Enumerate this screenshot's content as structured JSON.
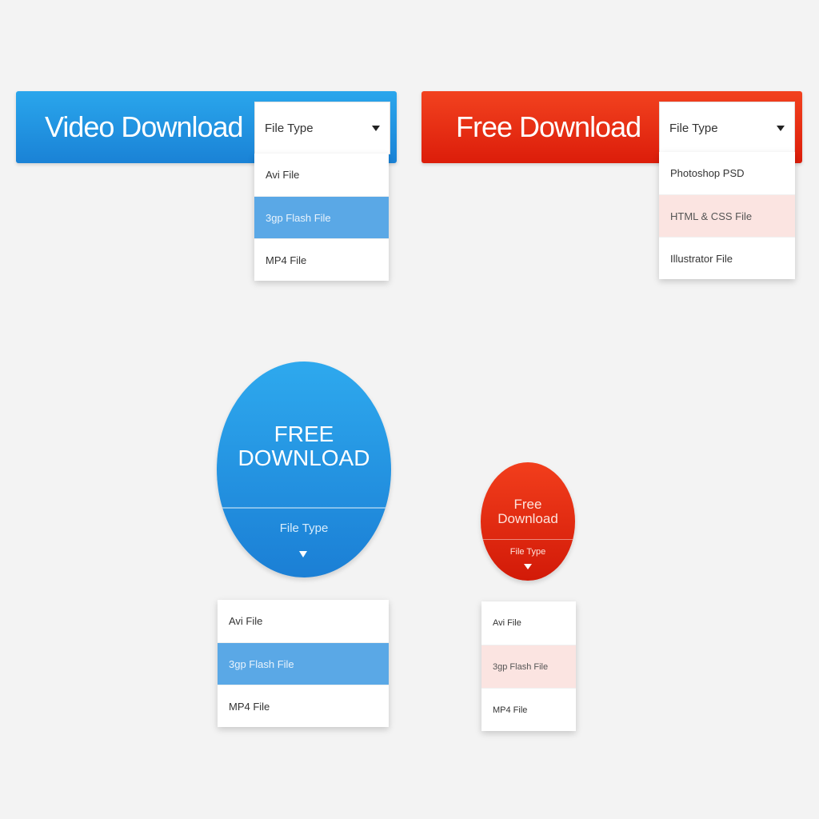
{
  "video_download": {
    "label": "Video Download",
    "select_label": "File Type",
    "options": [
      "Avi File",
      "3gp Flash File",
      "MP4 File"
    ],
    "selected_index": 1,
    "accent": "#1f90e0"
  },
  "free_download": {
    "label": "Free Download",
    "select_label": "File Type",
    "options": [
      "Photoshop PSD",
      "HTML & CSS File",
      "Illustrator File"
    ],
    "selected_index": 1,
    "accent": "#e8290f"
  },
  "circle_large": {
    "line1": "FREE",
    "line2": "DOWNLOAD",
    "select_label": "File Type",
    "options": [
      "Avi File",
      "3gp Flash File",
      "MP4 File"
    ],
    "selected_index": 1,
    "accent": "#1f90e0"
  },
  "circle_small": {
    "line1": "Free",
    "line2": "Download",
    "select_label": "File Type",
    "options": [
      "Avi File",
      "3gp Flash File",
      "MP4 File"
    ],
    "selected_index": 1,
    "accent": "#e8290f"
  }
}
